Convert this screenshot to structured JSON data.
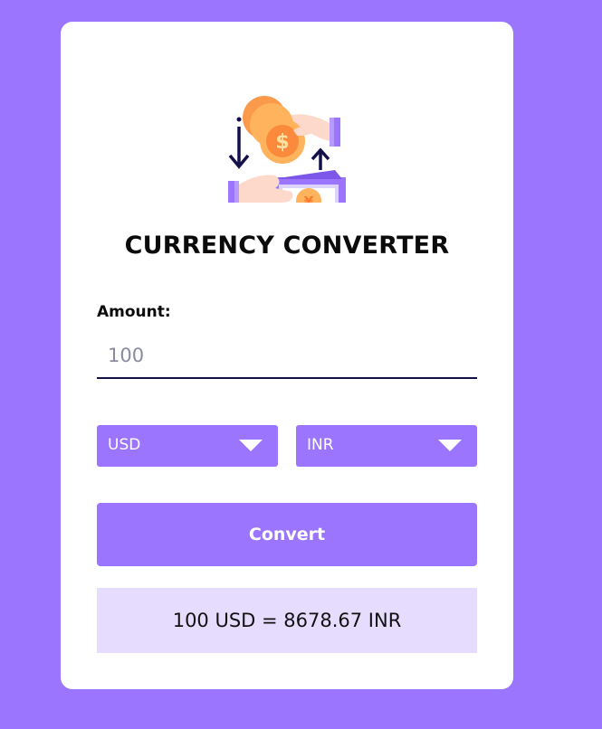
{
  "app": {
    "title": "CURRENCY CONVERTER",
    "accent_color": "#9b75fe",
    "result_bg_color": "#e6ddfe",
    "illustration_icon": "money-exchange-icon"
  },
  "form": {
    "amount_label": "Amount:",
    "amount_placeholder": "100",
    "amount_value": "",
    "from_currency": "USD",
    "to_currency": "INR",
    "convert_label": "Convert"
  },
  "result": {
    "text": "100 USD = 8678.67 INR"
  }
}
